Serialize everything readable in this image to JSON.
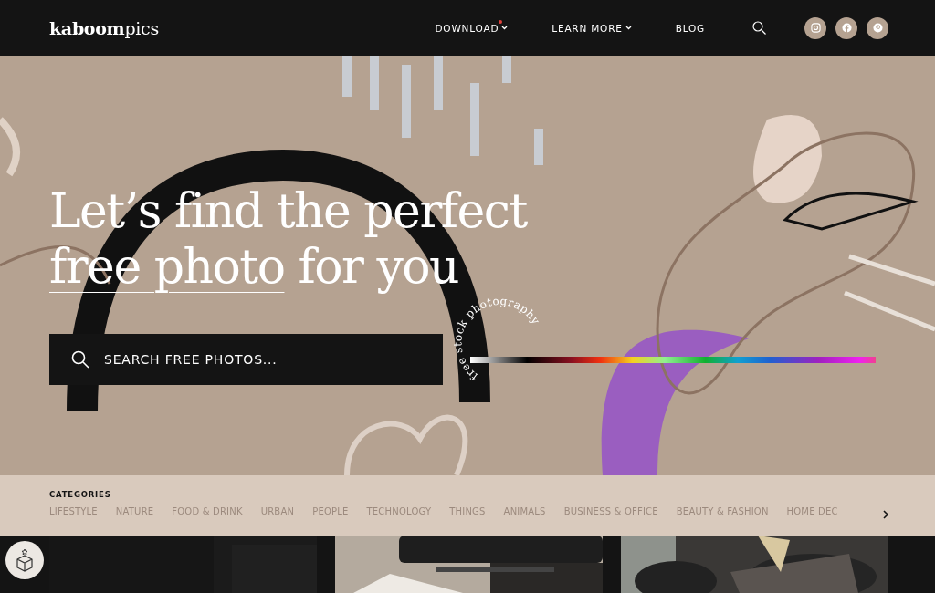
{
  "header": {
    "logo_bold": "kaboom",
    "logo_light": "pics",
    "nav": [
      {
        "label": "DOWNLOAD",
        "has_caret": true,
        "notification_dot": true
      },
      {
        "label": "LEARN MORE",
        "has_caret": true,
        "notification_dot": false
      },
      {
        "label": "BLOG",
        "has_caret": false,
        "notification_dot": false
      }
    ],
    "social": [
      {
        "kind": "instagram"
      },
      {
        "kind": "facebook"
      },
      {
        "kind": "pinterest"
      }
    ]
  },
  "hero": {
    "headline_line1": "Let’s find the perfect",
    "headline_link": "free photo",
    "headline_rest": "for you",
    "search": {
      "placeholder": "SEARCH FREE PHOTOS..."
    },
    "badge_text": "free stock photography"
  },
  "categories": {
    "title": "CATEGORIES",
    "items": [
      "LIFESTYLE",
      "NATURE",
      "FOOD & DRINK",
      "URBAN",
      "PEOPLE",
      "TECHNOLOGY",
      "THINGS",
      "ANIMALS",
      "BUSINESS & OFFICE",
      "BEAUTY & FASHION",
      "HOME DEC"
    ]
  }
}
